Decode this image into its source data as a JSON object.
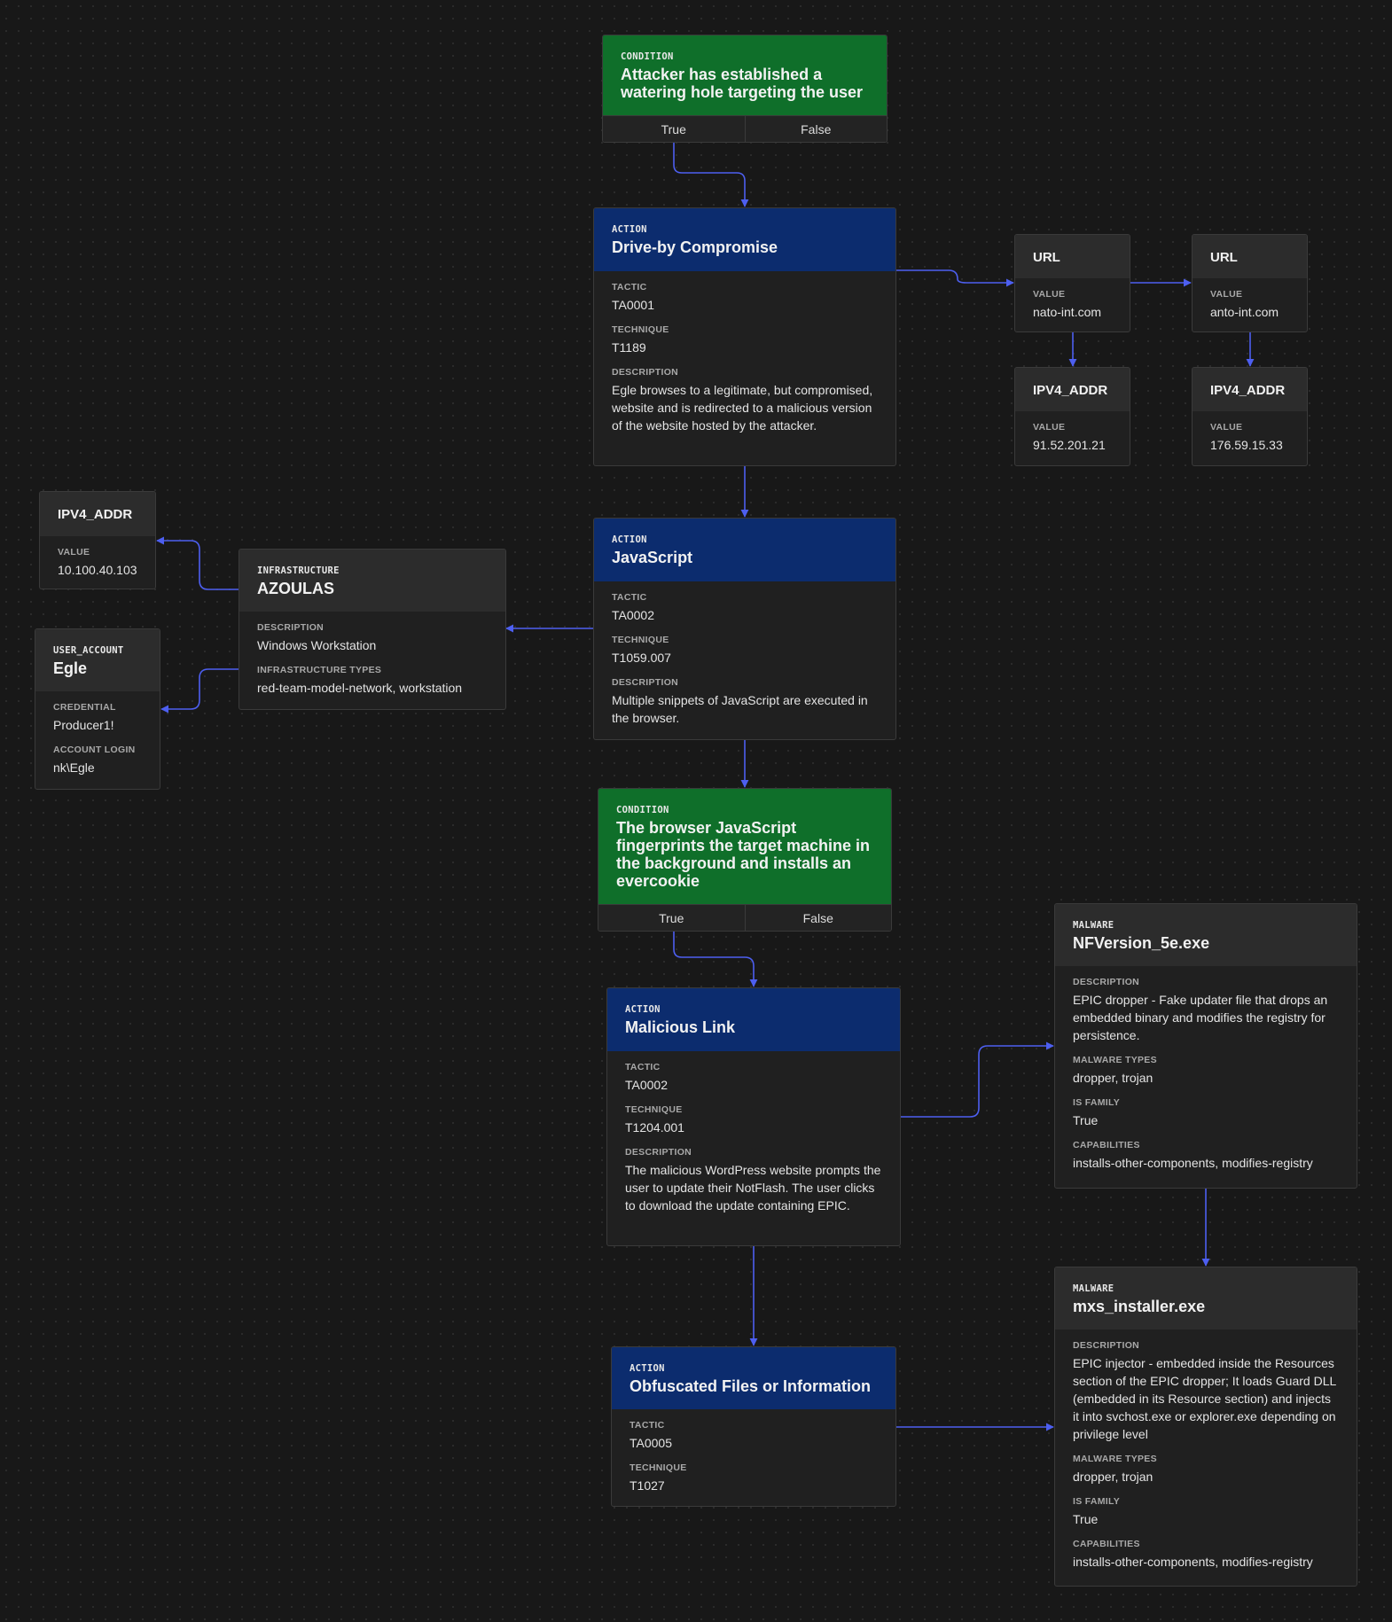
{
  "colors": {
    "background": "#181818",
    "action_header": "#0c2c6e",
    "condition_header": "#0f6f2a",
    "node_body": "#202020",
    "edge": "#4d5ff0"
  },
  "nodes": {
    "cond1": {
      "kind": "Condition",
      "title": "Attacker has established a watering hole targeting the user",
      "true_label": "True",
      "false_label": "False"
    },
    "action1": {
      "kind": "Action",
      "title": "Drive-by Compromise",
      "tactic_label": "Tactic",
      "tactic": "TA0001",
      "technique_label": "Technique",
      "technique": "T1189",
      "description_label": "Description",
      "description": "Egle browses to a legitimate, but compromised, website and is redirected to a malicious version of the website hosted by the attacker."
    },
    "url1": {
      "title": "URL",
      "value_label": "Value",
      "value": "nato-int.com"
    },
    "url2": {
      "title": "URL",
      "value_label": "Value",
      "value": "anto-int.com"
    },
    "ip1": {
      "title": "IPV4_ADDR",
      "value_label": "Value",
      "value": "91.52.201.21"
    },
    "ip2": {
      "title": "IPV4_ADDR",
      "value_label": "Value",
      "value": "176.59.15.33"
    },
    "action2": {
      "kind": "Action",
      "title": "JavaScript",
      "tactic_label": "Tactic",
      "tactic": "TA0002",
      "technique_label": "Technique",
      "technique": "T1059.007",
      "description_label": "Description",
      "description": "Multiple snippets of JavaScript are executed in the browser."
    },
    "infra": {
      "kind": "Infrastructure",
      "title": "AZOULAS",
      "description_label": "Description",
      "description": "Windows Workstation",
      "types_label": "Infrastructure Types",
      "types": "red-team-model-network, workstation"
    },
    "ip3": {
      "title": "IPV4_ADDR",
      "value_label": "Value",
      "value": "10.100.40.103"
    },
    "user": {
      "kind": "User_Account",
      "title": "Egle",
      "credential_label": "Credential",
      "credential": "Producer1!",
      "login_label": "Account Login",
      "login": "nk\\Egle"
    },
    "cond2": {
      "kind": "Condition",
      "title": "The browser JavaScript fingerprints the target machine in the background and installs an evercookie",
      "true_label": "True",
      "false_label": "False"
    },
    "action3": {
      "kind": "Action",
      "title": "Malicious Link",
      "tactic_label": "Tactic",
      "tactic": "TA0002",
      "technique_label": "Technique",
      "technique": "T1204.001",
      "description_label": "Description",
      "description": "The malicious WordPress website prompts the user to update their NotFlash. The user clicks to download the update containing EPIC."
    },
    "mal1": {
      "kind": "Malware",
      "title": "NFVersion_5e.exe",
      "description_label": "Description",
      "description": "EPIC dropper - Fake updater file that drops an embedded binary and modifies the registry for persistence.",
      "types_label": "Malware Types",
      "types": "dropper, trojan",
      "family_label": "Is Family",
      "family": "True",
      "capabilities_label": "Capabilities",
      "capabilities": "installs-other-components, modifies-registry"
    },
    "mal2": {
      "kind": "Malware",
      "title": "mxs_installer.exe",
      "description_label": "Description",
      "description": "EPIC injector - embedded inside the Resources section of the EPIC dropper; It loads Guard DLL (embedded in its Resource section) and injects it into svchost.exe or explorer.exe depending on privilege level",
      "types_label": "Malware Types",
      "types": "dropper, trojan",
      "family_label": "Is Family",
      "family": "True",
      "capabilities_label": "Capabilities",
      "capabilities": "installs-other-components, modifies-registry"
    },
    "action4": {
      "kind": "Action",
      "title": "Obfuscated Files or Information",
      "tactic_label": "Tactic",
      "tactic": "TA0005",
      "technique_label": "Technique",
      "technique": "T1027"
    }
  }
}
